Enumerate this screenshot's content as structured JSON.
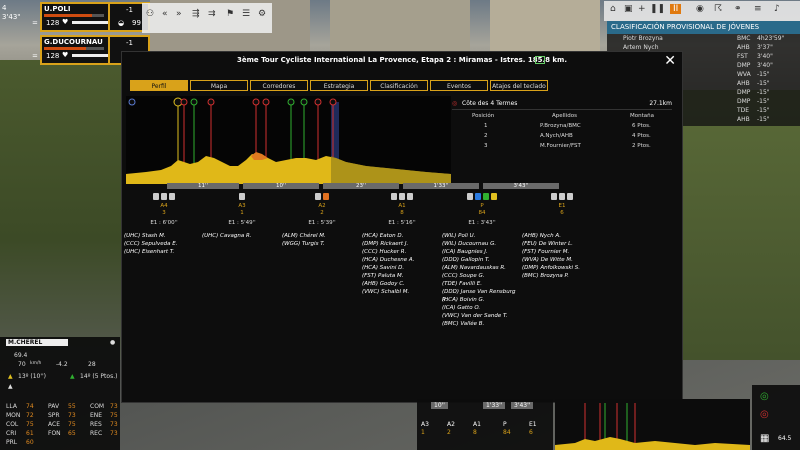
{
  "top_left": {
    "rank": "4",
    "gap": "3'43\"",
    "riders": [
      {
        "name": "U.POLI",
        "energy": "128",
        "tag": "-1",
        "effort": 0.8
      },
      {
        "name": "G.DUCOURNAU",
        "energy": "128",
        "tag": "-1",
        "effort": 0.7
      }
    ],
    "ctrl_value": "99",
    "sep": "="
  },
  "toolbar": {
    "icons": [
      "people-icon",
      "rewind-icon",
      "fast-forward-icon",
      "split-icon",
      "join-icon",
      "flag-icon",
      "list-icon",
      "settings-icon"
    ]
  },
  "top_right": {
    "icons": [
      "home-icon",
      "camera-icon",
      "plus-icon",
      "pause-icon",
      "speed-icon",
      "menu-icon"
    ],
    "speed_label": "II"
  },
  "classification": {
    "title": "CLASIFICACIÓN PROVISIONAL DE JÓVENES",
    "rows": [
      {
        "name": "Piotr Brozyna",
        "team": "BMC",
        "time": "4h23'59\""
      },
      {
        "name": "Artem Nych",
        "team": "AHB",
        "time": "3'37\""
      },
      {
        "name": "",
        "team": "FST",
        "time": "3'40\""
      },
      {
        "name": "kowski",
        "team": "DMP",
        "time": "3'40\""
      },
      {
        "name": "rger",
        "team": "WVA",
        "time": "-15\""
      },
      {
        "name": "",
        "team": "AHB",
        "time": "-15\""
      },
      {
        "name": "",
        "team": "DMP",
        "time": "-15\""
      },
      {
        "name": "",
        "team": "DMP",
        "time": "-15\""
      },
      {
        "name": "",
        "team": "TDE",
        "time": "-15\""
      },
      {
        "name": "",
        "team": "AHB",
        "time": "-15\""
      }
    ]
  },
  "modal": {
    "title": "3ème Tour Cycliste International La Provence, Etapa 2 : Miramas - Istres. 185.8 km.",
    "close": "✕",
    "tabs": [
      "Perfil",
      "Mapa",
      "Corredores",
      "Estrategia",
      "Clasificación",
      "Eventos",
      "Atajos del teclado"
    ],
    "active_tab": "Perfil",
    "climb": {
      "name": "Côte des 4 Termes",
      "length": "27.1km",
      "headers": [
        "Posición",
        "Apellidos",
        "Montaña"
      ],
      "rows": [
        {
          "pos": "1",
          "name": "P.Brozyna/BMC",
          "pts": "6 Ptos."
        },
        {
          "pos": "2",
          "name": "A.Nych/AHB",
          "pts": "4 Ptos."
        },
        {
          "pos": "3",
          "name": "M.Fournier/FST",
          "pts": "2 Ptos."
        }
      ]
    },
    "gaps": [
      "11''",
      "10''",
      "23''",
      "1'33''",
      "3'43''"
    ],
    "groups": [
      {
        "code": "A4",
        "count": "3",
        "time": "E1 : 6'00''",
        "jerseys": [
          "#cccccc",
          "#cccccc",
          "#cccccc"
        ],
        "members": [
          "(UHC) Stash M.",
          "(CCC) Sepulveda E.",
          "(UHC) Eisenhart T."
        ]
      },
      {
        "code": "A3",
        "count": "1",
        "time": "E1 : 5'49''",
        "jerseys": [
          "#cccccc"
        ],
        "members": [
          "(UHC) Cavagna R."
        ]
      },
      {
        "code": "A2",
        "count": "2",
        "time": "E1 : 5'39''",
        "jerseys": [
          "#cccccc",
          "#e07020"
        ],
        "members": [
          "(ALM) Chérel M.",
          "(WGG) Turgis T."
        ]
      },
      {
        "code": "A1",
        "count": "8",
        "time": "E1 : 5'16''",
        "jerseys": [
          "#cccccc",
          "#cccccc",
          "#cccccc"
        ],
        "members": [
          "(HCA) Eaton D.",
          "(DMP) Rickaert J.",
          "(CCC) Hucker R.",
          "(HCA) Duchesne A.",
          "(HCA) Savini D.",
          "(FST) Paluta M.",
          "(AHB) Godoy C.",
          "(VWC) Schalbl M."
        ]
      },
      {
        "code": "P",
        "count": "84",
        "time": "E1 : 3'43''",
        "jerseys": [
          "#cccccc",
          "#2a7ae0",
          "#30b030",
          "#e0c020"
        ],
        "members": [
          "(WIL) Poli U.",
          "(WIL) Ducournau G.",
          "(ICA) Baugnies J.",
          "(DDD) Gallopin T.",
          "(ALM) Navardauskas R.",
          "(CCC) Soupe G.",
          "(TDE) Favilli E.",
          "(DDD) Janse Van Rensburg R.",
          "(HCA) Boivin G.",
          "(ICA) Gatto O.",
          "(VWC) Van der Sande T.",
          "(BMC) Vallée B."
        ]
      },
      {
        "code": "E1",
        "count": "6",
        "time": "",
        "jerseys": [
          "#cccccc",
          "#cccccc",
          "#cccccc"
        ],
        "members": [
          "(AHB) Nych A.",
          "(FEU) De Winter L.",
          "(FST) Fournier M.",
          "(WVA) De Witte M.",
          "(DMP) Anfolkowski S.",
          "(BMC) Brozyna P."
        ]
      }
    ]
  },
  "rider_panel": {
    "name": "M.CHÉREL",
    "weight": "69.4",
    "speed": "70",
    "speed_unit": "km/h",
    "grade": "-4.2",
    "energy": "28",
    "position": "13º (10'')",
    "mountain": "14º (5 Ptos.)",
    "stats": [
      {
        "k": "LLA",
        "v": "74"
      },
      {
        "k": "MON",
        "v": "72"
      },
      {
        "k": "COL",
        "v": "75"
      },
      {
        "k": "CRI",
        "v": "61"
      },
      {
        "k": "PRL",
        "v": "60"
      },
      {
        "k": "PAV",
        "v": "55"
      },
      {
        "k": "SPR",
        "v": "73"
      },
      {
        "k": "ACE",
        "v": "75"
      },
      {
        "k": "FON",
        "v": "65"
      },
      {
        "k": "COM",
        "v": "73"
      },
      {
        "k": "ENE",
        "v": "75"
      },
      {
        "k": "RES",
        "v": "73"
      },
      {
        "k": "REC",
        "v": "73"
      }
    ]
  },
  "bottom_strip": {
    "gaps": [
      "10''",
      "1'33''",
      "3'43''"
    ],
    "groups": [
      {
        "code": "A3",
        "count": "1"
      },
      {
        "code": "A2",
        "count": "2"
      },
      {
        "code": "A1",
        "count": "8"
      },
      {
        "code": "P",
        "count": "84"
      },
      {
        "code": "E1",
        "count": "6"
      }
    ]
  },
  "bottom_right": {
    "km_left": "64.5"
  }
}
